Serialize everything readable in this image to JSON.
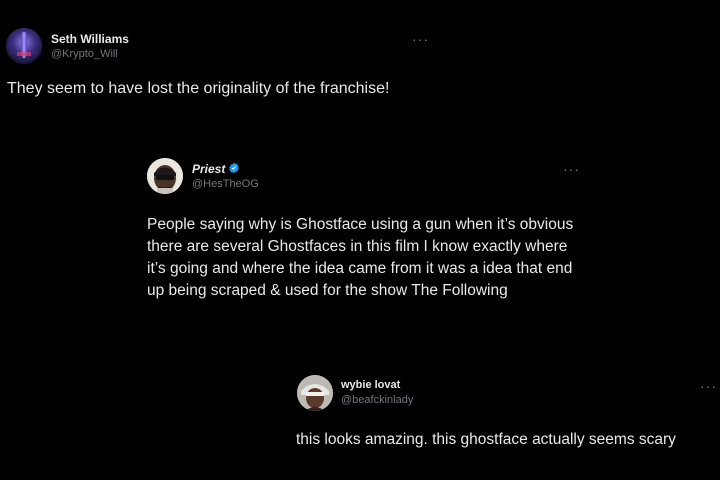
{
  "tweets": [
    {
      "name": "Seth Williams",
      "handle": "@Krypto_Will",
      "more": "···",
      "text": "They seem to have lost the originality of the franchise!"
    },
    {
      "name": "Priest",
      "handle": "@HesTheOG",
      "more": "···",
      "verified": true,
      "text": "People saying why is Ghostface using a gun when it’s obvious there are several Ghostfaces in this film I know exactly where it’s going and where the idea came from it was a idea that end up being scraped & used for the show The Following"
    },
    {
      "name": "wybie lovat",
      "handle": "@beafckinlady",
      "more": "···",
      "text": "this looks amazing. this ghostface actually seems scary"
    }
  ],
  "colors": {
    "background": "#000000",
    "text": "#e7e9ea",
    "secondary": "#71767b",
    "verified": "#1d9bf0"
  }
}
